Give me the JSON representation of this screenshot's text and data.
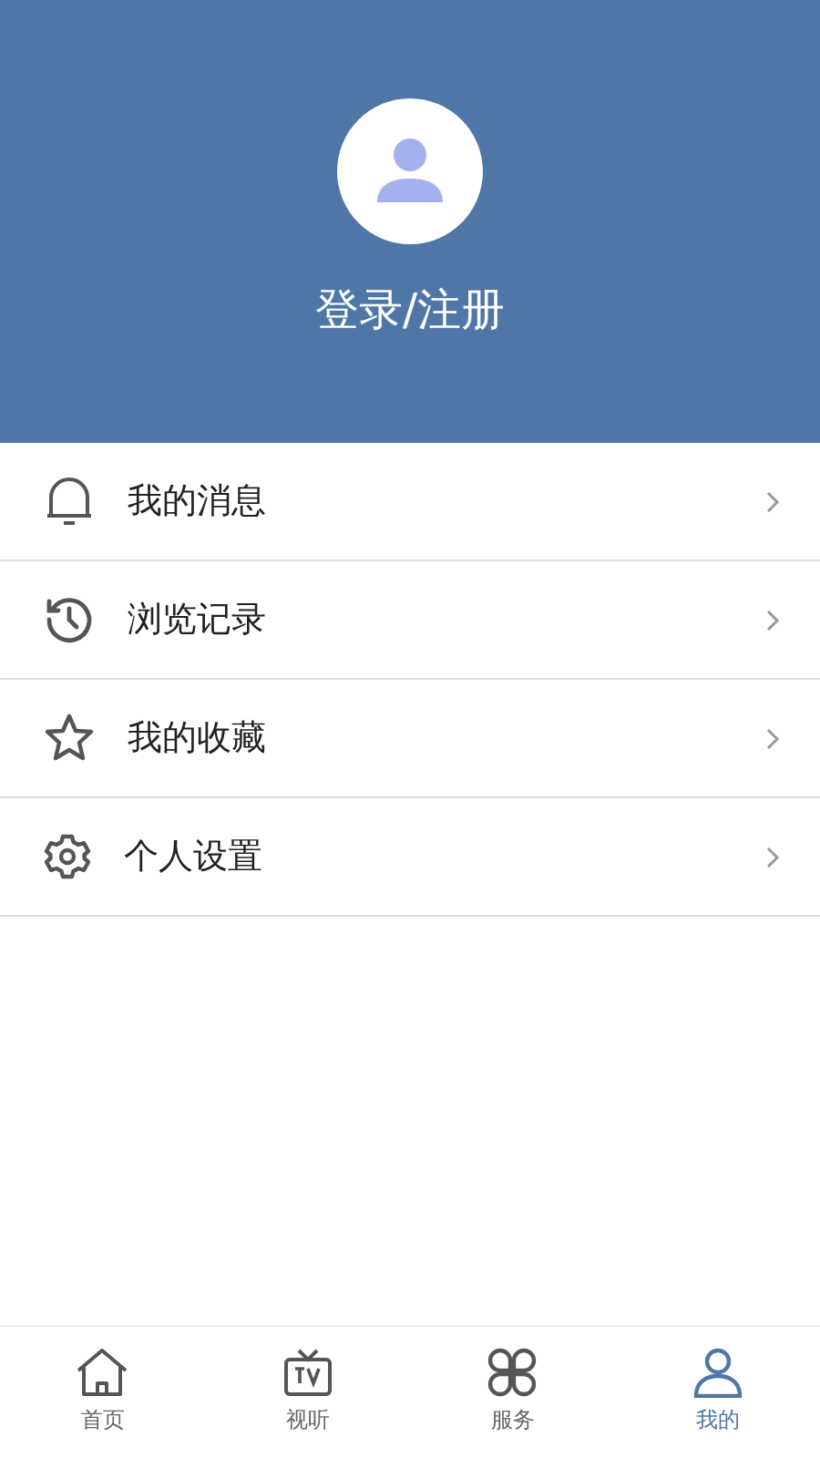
{
  "header": {
    "login": "登录/注册"
  },
  "menu": [
    {
      "kind": "bell",
      "label": "我的消息"
    },
    {
      "kind": "history",
      "label": "浏览记录"
    },
    {
      "kind": "star",
      "label": "我的收藏"
    },
    {
      "kind": "gear",
      "label": "个人设置"
    }
  ],
  "tabs": [
    {
      "kind": "home",
      "label": "首页",
      "selected": false
    },
    {
      "kind": "tv",
      "label": "视听",
      "selected": false
    },
    {
      "kind": "clover",
      "label": "服务",
      "selected": false
    },
    {
      "kind": "user",
      "label": "我的",
      "selected": true
    }
  ]
}
